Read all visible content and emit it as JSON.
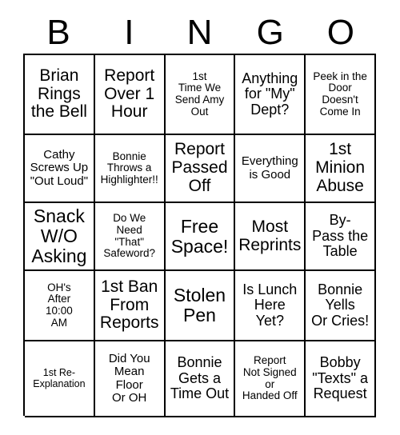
{
  "card": {
    "header_letters": [
      "B",
      "I",
      "N",
      "G",
      "O"
    ],
    "rows": [
      [
        {
          "text": "Brian\nRings\nthe Bell",
          "size": "lg"
        },
        {
          "text": "Report\nOver 1\nHour",
          "size": "lg"
        },
        {
          "text": "1st\nTime We\nSend Amy\nOut",
          "size": "xs"
        },
        {
          "text": "Anything\nfor \"My\"\nDept?",
          "size": "md"
        },
        {
          "text": "Peek in the\nDoor\nDoesn't\nCome In",
          "size": "xs"
        }
      ],
      [
        {
          "text": "Cathy\nScrews Up\n\"Out Loud\"",
          "size": "sm"
        },
        {
          "text": "Bonnie\nThrows a\nHighlighter!!",
          "size": "xs"
        },
        {
          "text": "Report\nPassed\nOff",
          "size": "lg"
        },
        {
          "text": "Everything\nis Good",
          "size": "sm"
        },
        {
          "text": "1st\nMinion\nAbuse",
          "size": "lg"
        }
      ],
      [
        {
          "text": "Snack\nW/O\nAsking",
          "size": "xl"
        },
        {
          "text": "Do We\nNeed\n\"That\"\nSafeword?",
          "size": "xs"
        },
        {
          "text": "Free\nSpace!",
          "size": "xl"
        },
        {
          "text": "Most\nReprints",
          "size": "lg"
        },
        {
          "text": "By-\nPass the\nTable",
          "size": "md"
        }
      ],
      [
        {
          "text": "OH's\nAfter\n10:00\nAM",
          "size": "xs"
        },
        {
          "text": "1st Ban\nFrom\nReports",
          "size": "lg"
        },
        {
          "text": "Stolen\nPen",
          "size": "xl"
        },
        {
          "text": "Is Lunch\nHere\nYet?",
          "size": "md"
        },
        {
          "text": "Bonnie\nYells\nOr Cries!",
          "size": "md"
        }
      ],
      [
        {
          "text": "1st Re-\nExplanation",
          "size": "xxs"
        },
        {
          "text": "Did You\nMean\nFloor\nOr OH",
          "size": "sm"
        },
        {
          "text": "Bonnie\nGets a\nTime Out",
          "size": "md"
        },
        {
          "text": "Report\nNot Signed\nor\nHanded Off",
          "size": "xs"
        },
        {
          "text": "Bobby\n\"Texts\" a\nRequest",
          "size": "md"
        }
      ]
    ]
  },
  "colors": {
    "background": "#ffffff",
    "text": "#000000",
    "border": "#000000"
  }
}
